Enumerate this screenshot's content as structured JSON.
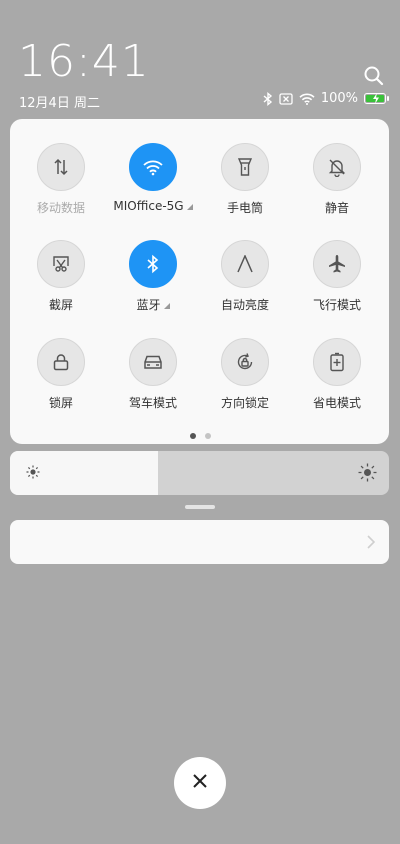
{
  "lockscreen": {
    "time": "16:41",
    "date": "12月4日 周二"
  },
  "status_bar": {
    "battery_percent": "100%",
    "icons": [
      "bluetooth-icon",
      "no-sim-icon",
      "wifi-icon",
      "battery-charging-icon"
    ]
  },
  "quick_settings": {
    "tiles": [
      {
        "label": "移动数据",
        "icon": "mobile-data-icon",
        "active": false,
        "dim": true
      },
      {
        "label": "MIOffice-5G",
        "icon": "wifi-icon",
        "active": true,
        "submenu": true
      },
      {
        "label": "手电筒",
        "icon": "flashlight-icon",
        "active": false
      },
      {
        "label": "静音",
        "icon": "mute-bell-icon",
        "active": false
      },
      {
        "label": "截屏",
        "icon": "screenshot-icon",
        "active": false
      },
      {
        "label": "蓝牙",
        "icon": "bluetooth-icon",
        "active": true,
        "submenu": true
      },
      {
        "label": "自动亮度",
        "icon": "auto-brightness-icon",
        "active": false
      },
      {
        "label": "飞行模式",
        "icon": "airplane-icon",
        "active": false
      },
      {
        "label": "锁屏",
        "icon": "lock-icon",
        "active": false
      },
      {
        "label": "驾车模式",
        "icon": "car-icon",
        "active": false
      },
      {
        "label": "方向锁定",
        "icon": "rotation-lock-icon",
        "active": false
      },
      {
        "label": "省电模式",
        "icon": "battery-saver-icon",
        "active": false
      }
    ],
    "page_indicator": {
      "current": 1,
      "total": 2
    }
  },
  "brightness": {
    "level": 0.39
  },
  "colors": {
    "accent": "#1e94f5",
    "panel": "#f9f9f9",
    "backdrop": "#a9a9a9"
  }
}
